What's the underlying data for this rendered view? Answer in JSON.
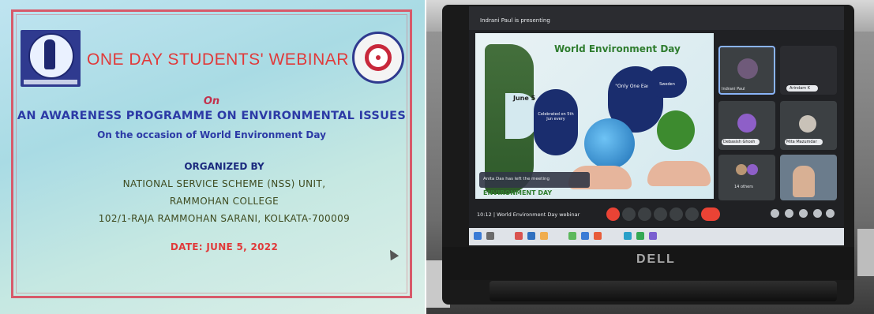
{
  "slide": {
    "title": "ONE DAY STUDENTS' WEBINAR",
    "on": "On",
    "topic": "AN AWARENESS PROGRAMME ON ENVIRONMENTAL ISSUES",
    "occasion": "On the occasion of World Environment Day",
    "organized_by": "ORGANIZED BY",
    "unit": "NATIONAL SERVICE SCHEME (NSS) UNIT,",
    "college": "RAMMOHAN COLLEGE",
    "address": "102/1-RAJA RAMMOHAN SARANI, KOLKATA-700009",
    "date": "DATE: JUNE 5, 2022"
  },
  "meeting": {
    "presenter_banner": "Indrani Paul is presenting",
    "shared_slide": {
      "title": "World Environment Day",
      "june": "June 5",
      "bubble_left": "Celebrated on 5th Jun every",
      "bubble_middle": "\"Only One Earth\"",
      "bubble_right": "Sweden",
      "footer": "ENVIRONMENT DAY"
    },
    "toast": "Anita Das has left the meeting",
    "participants": [
      {
        "name": "Indrani Paul"
      },
      {
        "name": "Arindam K"
      },
      {
        "name": "Debasish Ghosh"
      },
      {
        "name": "Mita Mazumdar"
      },
      {
        "name": "14 others"
      }
    ],
    "time": "10:12",
    "meeting_name": "World Environment Day webinar"
  },
  "laptop": {
    "brand": "DELL"
  },
  "colors": {
    "slide_border": "#d75a6a",
    "title_red": "#e03a3a",
    "navy_text": "#2c3aa6",
    "meet_end_red": "#ea4335"
  }
}
